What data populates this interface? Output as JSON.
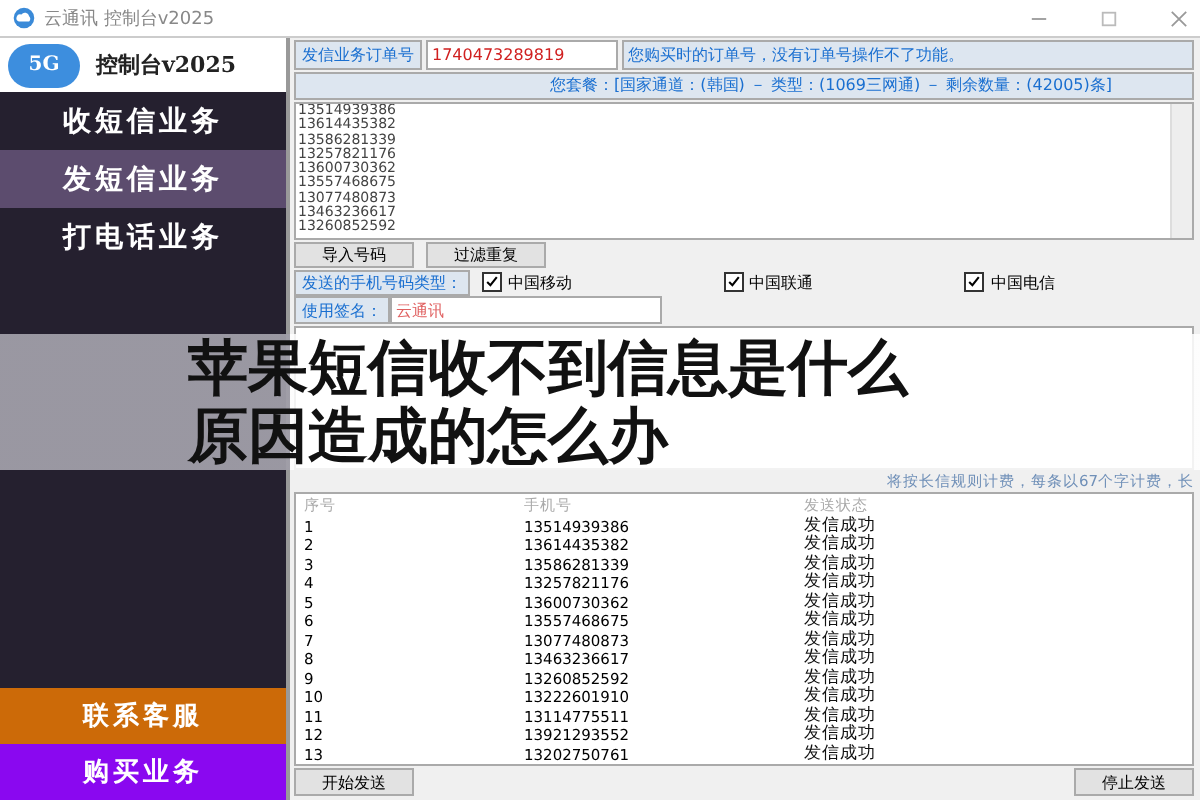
{
  "window": {
    "title": "云通讯 控制台v2025"
  },
  "sidebar": {
    "logo_badge": "5G",
    "logo_text": "控制台v2025",
    "items": [
      {
        "label": "收短信业务",
        "selected": false
      },
      {
        "label": "发短信业务",
        "selected": true
      },
      {
        "label": "打电话业务",
        "selected": false
      }
    ],
    "bottom_items": [
      {
        "label": "联系客服",
        "color": "#cc6a08"
      },
      {
        "label": "购买业务",
        "color": "#8a08f0"
      }
    ]
  },
  "order": {
    "label": "发信业务订单号",
    "value": "1740473289819",
    "hint": "您购买时的订单号，没有订单号操作不了功能。"
  },
  "package": "您套餐：[国家通道：(韩国) － 类型：(1069三网通) － 剩余数量：(42005)条]",
  "numbers": [
    "13514939386",
    "13614435382",
    "13586281339",
    "13257821176",
    "13600730362",
    "13557468675",
    "13077480873",
    "13463236617",
    "13260852592"
  ],
  "number_buttons": [
    "导入号码",
    "过滤重复"
  ],
  "carriers": {
    "label": "发送的手机号码类型：",
    "items": [
      {
        "label": "中国移动",
        "checked": true
      },
      {
        "label": "中国联通",
        "checked": true
      },
      {
        "label": "中国电信",
        "checked": true
      }
    ]
  },
  "signature": {
    "label": "使用签名：",
    "value": "云通讯"
  },
  "note": "将按长信规则计费，每条以67个字计费，长",
  "table": {
    "columns": [
      "序号",
      "手机号",
      "发送状态"
    ],
    "rows": [
      [
        "1",
        "13514939386",
        "发信成功"
      ],
      [
        "2",
        "13614435382",
        "发信成功"
      ],
      [
        "3",
        "13586281339",
        "发信成功"
      ],
      [
        "4",
        "13257821176",
        "发信成功"
      ],
      [
        "5",
        "13600730362",
        "发信成功"
      ],
      [
        "6",
        "13557468675",
        "发信成功"
      ],
      [
        "7",
        "13077480873",
        "发信成功"
      ],
      [
        "8",
        "13463236617",
        "发信成功"
      ],
      [
        "9",
        "13260852592",
        "发信成功"
      ],
      [
        "10",
        "13222601910",
        "发信成功"
      ],
      [
        "11",
        "13114775511",
        "发信成功"
      ],
      [
        "12",
        "13921293552",
        "发信成功"
      ],
      [
        "13",
        "13202750761",
        "发信成功"
      ]
    ]
  },
  "actions": [
    "开始发送",
    "停止发送"
  ],
  "overlay_title": [
    "苹果短信收不到信息是什么",
    "原因造成的怎么办"
  ]
}
